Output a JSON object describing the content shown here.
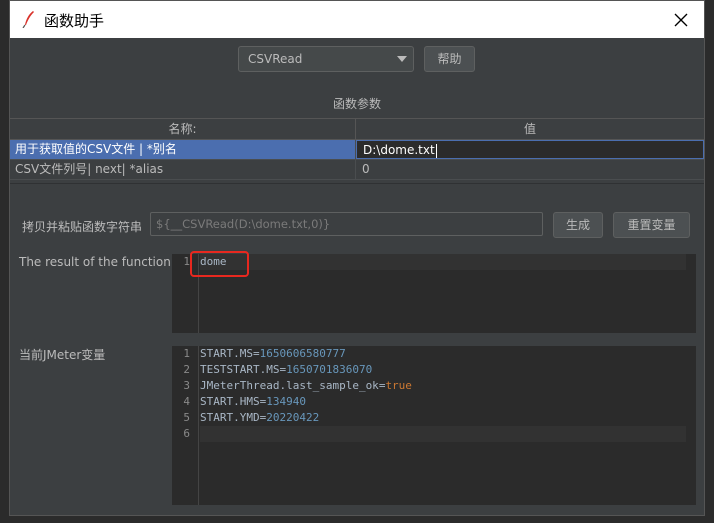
{
  "window": {
    "title": "函数助手",
    "close_label": "✕"
  },
  "function_select": {
    "value": "CSVRead"
  },
  "help_button": "帮助",
  "params_section": "函数参数",
  "table": {
    "headers": [
      "名称:",
      "值"
    ],
    "rows": [
      {
        "name": "用于获取值的CSV文件 | *别名",
        "value": "D:\\dome.txt"
      },
      {
        "name": "CSV文件列号| next| *alias",
        "value": "0"
      }
    ]
  },
  "copy_label": "拷贝并粘贴函数字符串",
  "copy_value": "${__CSVRead(D:\\dome.txt,0)}",
  "generate_button": "生成",
  "reset_button": "重置变量",
  "result_label": "The result of the function is",
  "result_lines": [
    "dome"
  ],
  "vars_label": "当前JMeter变量",
  "vars_lines": [
    {
      "key": "START.MS",
      "value": "1650606580777",
      "type": "number"
    },
    {
      "key": "TESTSTART.MS",
      "value": "1650701836070",
      "type": "number"
    },
    {
      "key": "JMeterThread.last_sample_ok",
      "value": "true",
      "type": "keyword"
    },
    {
      "key": "START.HMS",
      "value": "134940",
      "type": "number"
    },
    {
      "key": "START.YMD",
      "value": "20220422",
      "type": "number"
    }
  ],
  "vars_line_numbers": [
    "1",
    "2",
    "3",
    "4",
    "5",
    "6"
  ],
  "result_line_numbers": [
    "1"
  ],
  "colors": {
    "selection": "#4b6eaf",
    "number": "#6897bb",
    "keyword": "#cc7832",
    "annotation": "#e8281f"
  }
}
